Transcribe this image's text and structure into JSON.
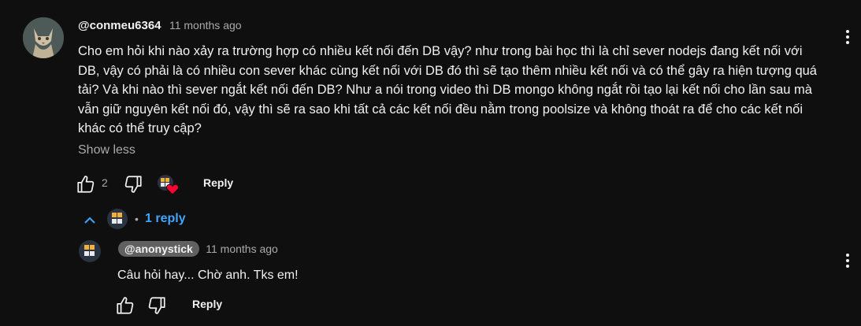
{
  "comment": {
    "handle": "@conmeu6364",
    "time": "11 months ago",
    "text": "Cho em hỏi khi nào xảy ra trường hợp có nhiều kết nối đến DB vậy? như trong bài học thì là chỉ sever nodejs đang kết nối với DB, vậy có phải là có nhiều con sever khác cùng kết nối với DB đó thì sẽ tạo thêm nhiều kết nối và có thể gây ra hiện tượng quá tải? Và khi nào thì sever ngắt kết nối đến DB? Như a nói trong video thì DB mongo không ngắt rồi tạo lại kết nối cho lần sau mà vẫn giữ nguyên kết nối đó, vậy thì sẽ ra sao khi tất cả các kết nối đều nằm trong poolsize và không thoát ra để cho các kết nối khác có thể truy cập?",
    "show_less": "Show less",
    "like_count": "2",
    "reply_label": "Reply",
    "replies_toggle": "1 reply",
    "dot": "•"
  },
  "reply": {
    "handle": "@anonystick",
    "time": "11 months ago",
    "text": "Câu hỏi hay... Chờ anh. Tks em!",
    "reply_label": "Reply"
  },
  "icons": {
    "like": "thumbs-up-icon",
    "dislike": "thumbs-down-icon",
    "heart": "creator-heart-icon",
    "chevron": "chevron-up-icon",
    "menu": "more-vert-icon"
  },
  "colors": {
    "background": "#0f0f0f",
    "link": "#3ea6ff",
    "secondary_text": "#aaaaaa",
    "heart": "#ff0033"
  }
}
